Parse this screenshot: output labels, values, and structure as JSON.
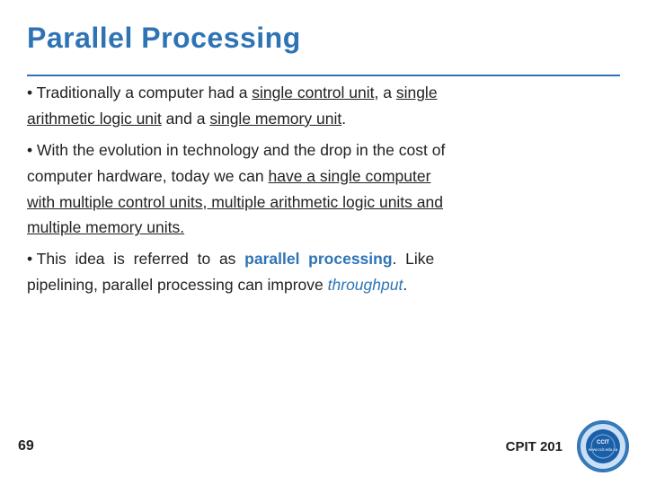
{
  "title": "Parallel Processing",
  "bullets": [
    {
      "id": "bullet1",
      "parts": [
        {
          "text": "• Traditionally a computer had a ",
          "style": "normal"
        },
        {
          "text": "single control unit",
          "style": "underline"
        },
        {
          "text": ", a ",
          "style": "normal"
        },
        {
          "text": "single",
          "style": "underline"
        },
        {
          "text": " ",
          "style": "normal"
        },
        {
          "text": "arithmetic logic unit",
          "style": "underline"
        },
        {
          "text": " and a ",
          "style": "normal"
        },
        {
          "text": "single memory unit",
          "style": "underline"
        },
        {
          "text": ".",
          "style": "normal"
        }
      ]
    },
    {
      "id": "bullet2",
      "parts": [
        {
          "text": "• With the evolution in technology and the drop in the cost of computer hardware, today we can ",
          "style": "normal"
        },
        {
          "text": "have a single computer with multiple control units, multiple arithmetic logic units and multiple memory units.",
          "style": "underline"
        }
      ]
    },
    {
      "id": "bullet3",
      "parts": [
        {
          "text": "• This idea is referred to as ",
          "style": "normal"
        },
        {
          "text": "parallel processing",
          "style": "parallel"
        },
        {
          "text": ". Like pipelining, parallel processing can improve ",
          "style": "normal"
        },
        {
          "text": "throughput",
          "style": "italic"
        },
        {
          "text": ".",
          "style": "normal"
        }
      ]
    }
  ],
  "footer": {
    "page_number": "69",
    "course_label": "CPIT 201"
  }
}
